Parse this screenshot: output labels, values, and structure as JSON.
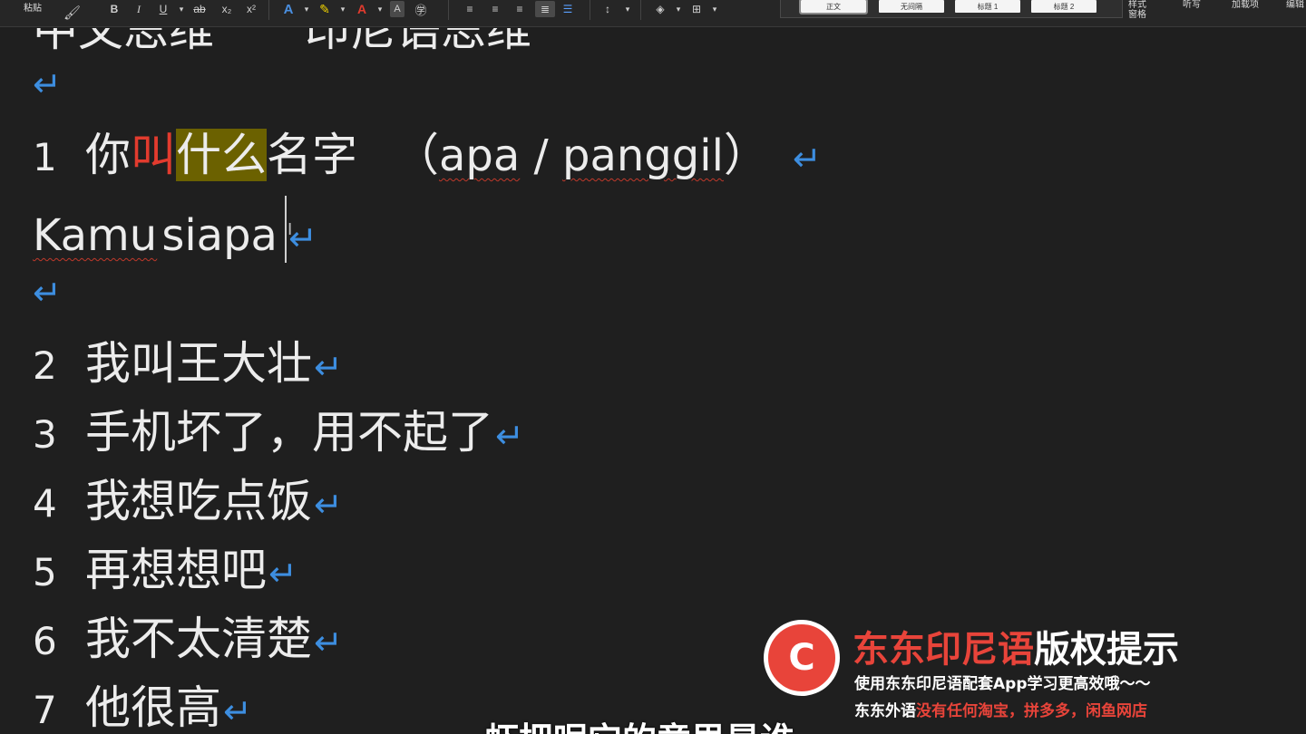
{
  "ribbon": {
    "paste": "粘贴",
    "bold": "B",
    "italic": "I",
    "underline": "U",
    "strike": "ab",
    "subscript": "x₂",
    "superscript": "x²",
    "styles": [
      "正文",
      "无间隔",
      "标题 1",
      "标题 2"
    ],
    "styles_pane": "样式\n窗格",
    "dictate": "听写",
    "addins": "加载项",
    "editor": "编辑"
  },
  "document": {
    "clipped_top": "中文思维　　印尼语思维",
    "line1": {
      "number": "1",
      "pre": "你",
      "red": "叫",
      "highlighted": "什么",
      "post": "名字",
      "paren_open": "（",
      "word1": "apa",
      "slash": " / ",
      "word2": "panggil",
      "paren_close": "）"
    },
    "line1_answer": {
      "word1": "Kamu",
      "word2": "siapa"
    },
    "items": [
      {
        "number": "2",
        "text": "我叫王大壮"
      },
      {
        "number": "3",
        "text": "手机坏了，用不起了"
      },
      {
        "number": "4",
        "text": "我想吃点饭"
      },
      {
        "number": "5",
        "text": "再想想吧"
      },
      {
        "number": "6",
        "text": "我不太清楚"
      },
      {
        "number": "7",
        "text": "他很高"
      }
    ],
    "paragraph_mark": "↵"
  },
  "watermark": {
    "logo_letter": "C",
    "brand": "东东印尼语",
    "copyright": "版权提示",
    "line1": "使用东东印尼语配套App学习更高效哦～～",
    "line2_white": "东东外语",
    "line2_red": "没有任何淘宝，拼多多，闲鱼网店"
  },
  "subtitle": "虾把呢它的意思是谁",
  "colors": {
    "accent_red": "#e8443a",
    "para_mark": "#3d8ee0",
    "highlight": "#6b6100"
  }
}
